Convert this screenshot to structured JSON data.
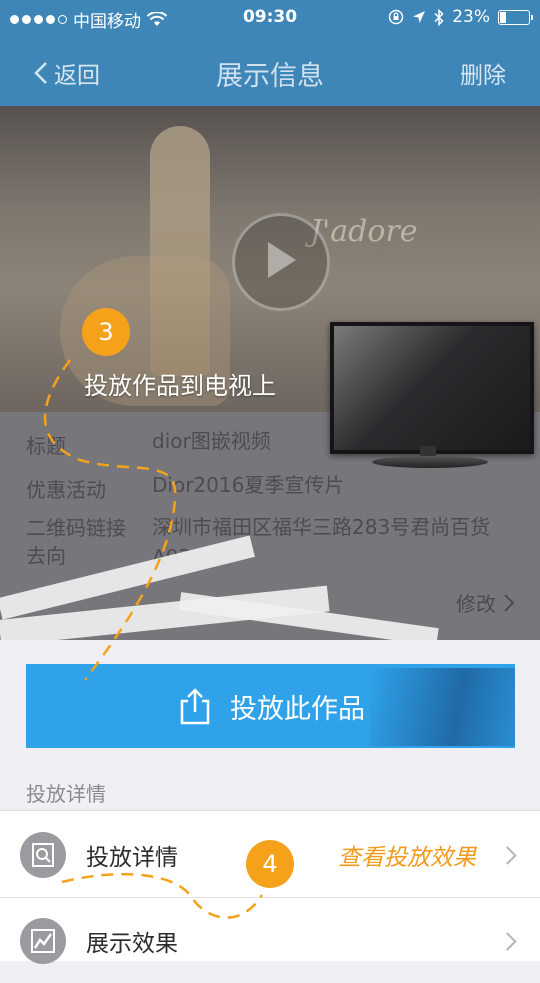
{
  "status_bar": {
    "carrier": "中国移动",
    "time": "09:30",
    "battery": "23%"
  },
  "nav": {
    "back_label": "返回",
    "title": "展示信息",
    "delete_label": "删除"
  },
  "info": {
    "rows": [
      {
        "label": "标题",
        "value": "dior图嵌视频"
      },
      {
        "label": "优惠活动",
        "value": "Dior2016夏季宣传片"
      },
      {
        "label": "二维码链接去向",
        "value": "深圳市福田区福华三路283号君尚百货A02"
      }
    ],
    "edit_label": "修改"
  },
  "callouts": {
    "step3_number": "3",
    "step3_text": "投放作品到电视上",
    "step4_number": "4",
    "step4_text": "查看投放效果"
  },
  "cast_button_label": "投放此作品",
  "section_header": "投放详情",
  "list": [
    {
      "label": "投放详情",
      "icon": "document-search-icon"
    },
    {
      "label": "展示效果",
      "icon": "line-chart-icon"
    }
  ]
}
